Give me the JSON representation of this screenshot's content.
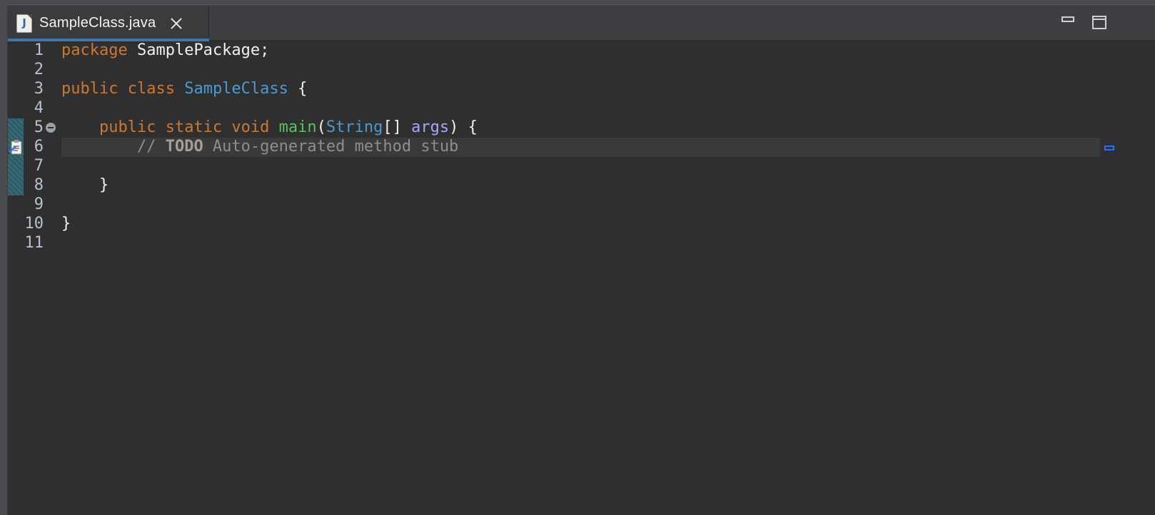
{
  "tab": {
    "filename": "SampleClass.java",
    "icon_letter": "J"
  },
  "window_controls": {
    "minimize_icon": "minimize-icon",
    "maximize_icon": "maximize-icon"
  },
  "code": {
    "lines": [
      {
        "number": "1",
        "tokens": [
          {
            "t": "package ",
            "c": "kw"
          },
          {
            "t": "SamplePackage;",
            "c": "plain"
          }
        ]
      },
      {
        "number": "2",
        "tokens": []
      },
      {
        "number": "3",
        "tokens": [
          {
            "t": "public ",
            "c": "kw"
          },
          {
            "t": "class ",
            "c": "kw"
          },
          {
            "t": "SampleClass",
            "c": "cls"
          },
          {
            "t": " {",
            "c": "plain"
          }
        ]
      },
      {
        "number": "4",
        "tokens": []
      },
      {
        "number": "5",
        "tokens": [
          {
            "t": "    ",
            "c": "plain"
          },
          {
            "t": "public ",
            "c": "kw"
          },
          {
            "t": "static ",
            "c": "kw"
          },
          {
            "t": "void ",
            "c": "kw"
          },
          {
            "t": "main",
            "c": "method"
          },
          {
            "t": "(",
            "c": "plain"
          },
          {
            "t": "String",
            "c": "cls"
          },
          {
            "t": "[] ",
            "c": "plain"
          },
          {
            "t": "args",
            "c": "param"
          },
          {
            "t": ") {",
            "c": "plain"
          }
        ]
      },
      {
        "number": "6",
        "tokens": [
          {
            "t": "        // ",
            "c": "comment"
          },
          {
            "t": "TODO",
            "c": "todo"
          },
          {
            "t": " Auto-generated method stub",
            "c": "comment"
          }
        ]
      },
      {
        "number": "7",
        "tokens": []
      },
      {
        "number": "8",
        "tokens": [
          {
            "t": "    }",
            "c": "plain"
          }
        ]
      },
      {
        "number": "9",
        "tokens": []
      },
      {
        "number": "10",
        "tokens": [
          {
            "t": "}",
            "c": "plain"
          }
        ]
      },
      {
        "number": "11",
        "tokens": []
      }
    ]
  },
  "colors": {
    "keyword": "#cc7832",
    "class_name": "#4a9bd0",
    "method": "#57c15a",
    "parameter": "#a0a8ff",
    "comment": "#8e8e8e",
    "background": "#2f2f2f",
    "tab_accent": "#3f76b0"
  }
}
